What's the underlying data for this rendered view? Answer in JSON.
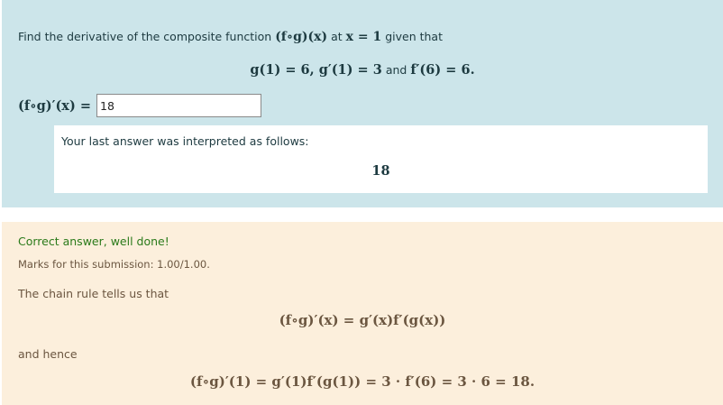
{
  "question": {
    "prompt_prefix": "Find the derivative of the composite function",
    "prompt_function": "(f∘g)(x)",
    "prompt_at": "at",
    "prompt_point": "x = 1",
    "prompt_suffix": "given that",
    "given_part1": "g(1) = 6, g′(1) = 3",
    "given_and": "and",
    "given_part2": "f′(6) = 6."
  },
  "answer": {
    "label": "(f∘g)′(x) =",
    "value": "18"
  },
  "validation": {
    "message": "Your last answer was interpreted as follows:",
    "interpreted": "18"
  },
  "feedback": {
    "correct_text": "Correct answer, well done!",
    "marks_text": "Marks for this submission: 1.00/1.00.",
    "chain_rule_text": "The chain rule tells us that",
    "equation1": "(f∘g)′(x) = g′(x)f′(g(x))",
    "hence_text": "and hence",
    "equation2": "(f∘g)′(1) = g′(1)f′(g(1)) = 3 · f′(6) = 3 · 6 = 18."
  },
  "colors": {
    "question_bg": "#cce5ea",
    "feedback_bg": "#fcefdc",
    "correct_green": "#2a7a1a"
  }
}
